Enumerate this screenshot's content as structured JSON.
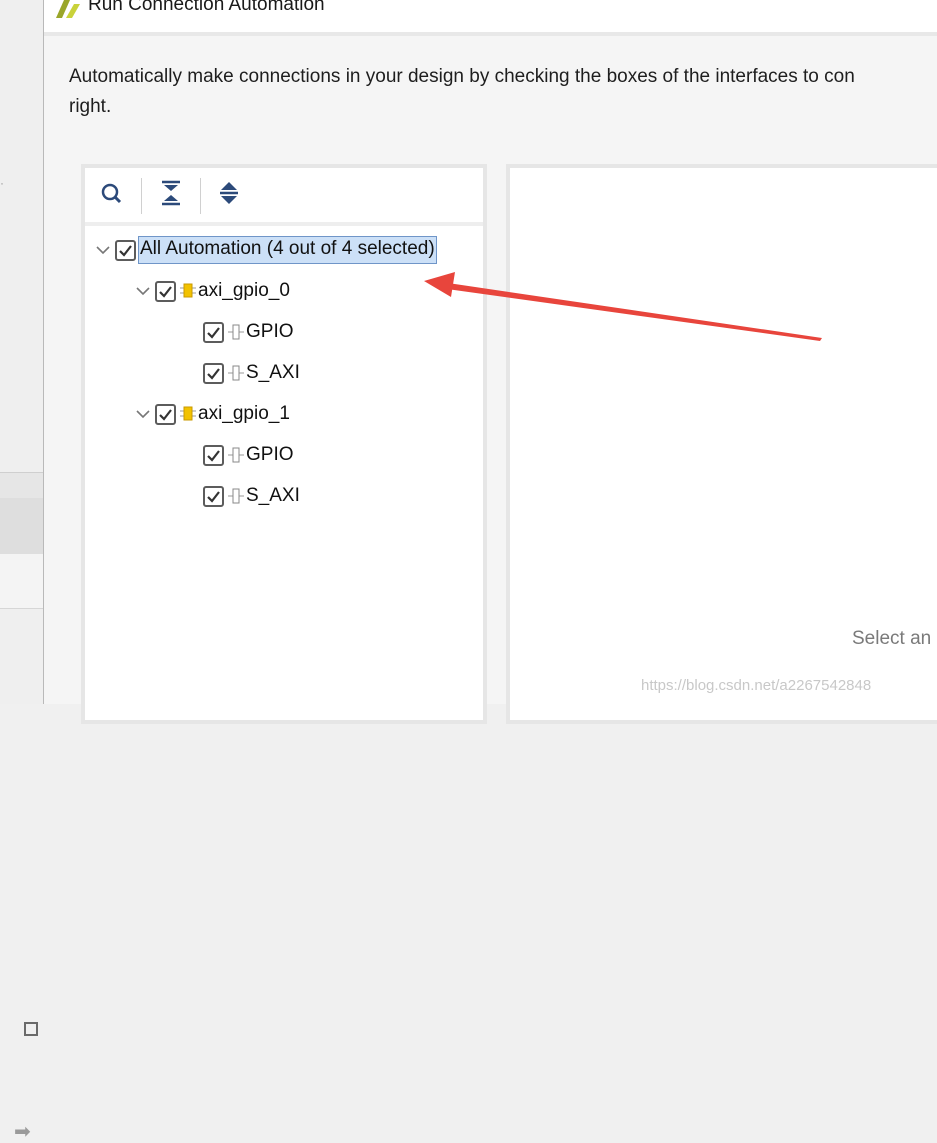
{
  "dialog": {
    "title": "Run Connection Automation",
    "description_line1": "Automatically make connections in your design by checking the boxes of the interfaces to con",
    "description_line2": "right."
  },
  "toolbar": {
    "search_icon": "search-icon",
    "collapse_all_icon": "collapse-all-icon",
    "expand_all_icon": "expand-all-icon"
  },
  "tree": {
    "root": {
      "label": "All Automation (4 out of 4 selected)",
      "checked": true
    },
    "groups": [
      {
        "label": "axi_gpio_0",
        "checked": true,
        "children": [
          {
            "label": "GPIO",
            "checked": true
          },
          {
            "label": "S_AXI",
            "checked": true
          }
        ]
      },
      {
        "label": "axi_gpio_1",
        "checked": true,
        "children": [
          {
            "label": "GPIO",
            "checked": true
          },
          {
            "label": "S_AXI",
            "checked": true
          }
        ]
      }
    ]
  },
  "right_panel": {
    "status_text": "Select an"
  },
  "watermark": "https://blog.csdn.net/a2267542848",
  "colors": {
    "annotation_arrow": "#e8453c",
    "selection_bg": "#cce0f7",
    "ip_icon": "#e8b100"
  }
}
